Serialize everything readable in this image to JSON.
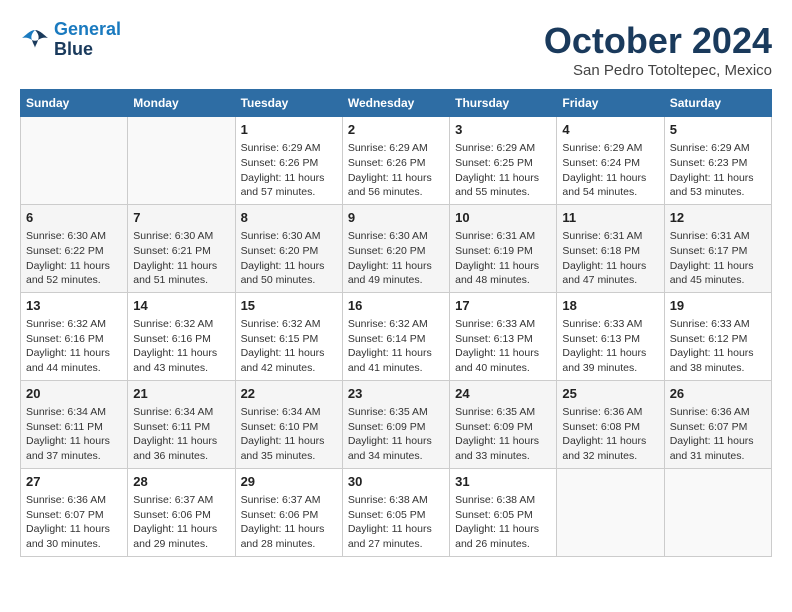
{
  "logo": {
    "line1": "General",
    "line2": "Blue"
  },
  "title": "October 2024",
  "subtitle": "San Pedro Totoltepec, Mexico",
  "weekdays": [
    "Sunday",
    "Monday",
    "Tuesday",
    "Wednesday",
    "Thursday",
    "Friday",
    "Saturday"
  ],
  "weeks": [
    [
      {
        "day": "",
        "info": ""
      },
      {
        "day": "",
        "info": ""
      },
      {
        "day": "1",
        "info": "Sunrise: 6:29 AM\nSunset: 6:26 PM\nDaylight: 11 hours and 57 minutes."
      },
      {
        "day": "2",
        "info": "Sunrise: 6:29 AM\nSunset: 6:26 PM\nDaylight: 11 hours and 56 minutes."
      },
      {
        "day": "3",
        "info": "Sunrise: 6:29 AM\nSunset: 6:25 PM\nDaylight: 11 hours and 55 minutes."
      },
      {
        "day": "4",
        "info": "Sunrise: 6:29 AM\nSunset: 6:24 PM\nDaylight: 11 hours and 54 minutes."
      },
      {
        "day": "5",
        "info": "Sunrise: 6:29 AM\nSunset: 6:23 PM\nDaylight: 11 hours and 53 minutes."
      }
    ],
    [
      {
        "day": "6",
        "info": "Sunrise: 6:30 AM\nSunset: 6:22 PM\nDaylight: 11 hours and 52 minutes."
      },
      {
        "day": "7",
        "info": "Sunrise: 6:30 AM\nSunset: 6:21 PM\nDaylight: 11 hours and 51 minutes."
      },
      {
        "day": "8",
        "info": "Sunrise: 6:30 AM\nSunset: 6:20 PM\nDaylight: 11 hours and 50 minutes."
      },
      {
        "day": "9",
        "info": "Sunrise: 6:30 AM\nSunset: 6:20 PM\nDaylight: 11 hours and 49 minutes."
      },
      {
        "day": "10",
        "info": "Sunrise: 6:31 AM\nSunset: 6:19 PM\nDaylight: 11 hours and 48 minutes."
      },
      {
        "day": "11",
        "info": "Sunrise: 6:31 AM\nSunset: 6:18 PM\nDaylight: 11 hours and 47 minutes."
      },
      {
        "day": "12",
        "info": "Sunrise: 6:31 AM\nSunset: 6:17 PM\nDaylight: 11 hours and 45 minutes."
      }
    ],
    [
      {
        "day": "13",
        "info": "Sunrise: 6:32 AM\nSunset: 6:16 PM\nDaylight: 11 hours and 44 minutes."
      },
      {
        "day": "14",
        "info": "Sunrise: 6:32 AM\nSunset: 6:16 PM\nDaylight: 11 hours and 43 minutes."
      },
      {
        "day": "15",
        "info": "Sunrise: 6:32 AM\nSunset: 6:15 PM\nDaylight: 11 hours and 42 minutes."
      },
      {
        "day": "16",
        "info": "Sunrise: 6:32 AM\nSunset: 6:14 PM\nDaylight: 11 hours and 41 minutes."
      },
      {
        "day": "17",
        "info": "Sunrise: 6:33 AM\nSunset: 6:13 PM\nDaylight: 11 hours and 40 minutes."
      },
      {
        "day": "18",
        "info": "Sunrise: 6:33 AM\nSunset: 6:13 PM\nDaylight: 11 hours and 39 minutes."
      },
      {
        "day": "19",
        "info": "Sunrise: 6:33 AM\nSunset: 6:12 PM\nDaylight: 11 hours and 38 minutes."
      }
    ],
    [
      {
        "day": "20",
        "info": "Sunrise: 6:34 AM\nSunset: 6:11 PM\nDaylight: 11 hours and 37 minutes."
      },
      {
        "day": "21",
        "info": "Sunrise: 6:34 AM\nSunset: 6:11 PM\nDaylight: 11 hours and 36 minutes."
      },
      {
        "day": "22",
        "info": "Sunrise: 6:34 AM\nSunset: 6:10 PM\nDaylight: 11 hours and 35 minutes."
      },
      {
        "day": "23",
        "info": "Sunrise: 6:35 AM\nSunset: 6:09 PM\nDaylight: 11 hours and 34 minutes."
      },
      {
        "day": "24",
        "info": "Sunrise: 6:35 AM\nSunset: 6:09 PM\nDaylight: 11 hours and 33 minutes."
      },
      {
        "day": "25",
        "info": "Sunrise: 6:36 AM\nSunset: 6:08 PM\nDaylight: 11 hours and 32 minutes."
      },
      {
        "day": "26",
        "info": "Sunrise: 6:36 AM\nSunset: 6:07 PM\nDaylight: 11 hours and 31 minutes."
      }
    ],
    [
      {
        "day": "27",
        "info": "Sunrise: 6:36 AM\nSunset: 6:07 PM\nDaylight: 11 hours and 30 minutes."
      },
      {
        "day": "28",
        "info": "Sunrise: 6:37 AM\nSunset: 6:06 PM\nDaylight: 11 hours and 29 minutes."
      },
      {
        "day": "29",
        "info": "Sunrise: 6:37 AM\nSunset: 6:06 PM\nDaylight: 11 hours and 28 minutes."
      },
      {
        "day": "30",
        "info": "Sunrise: 6:38 AM\nSunset: 6:05 PM\nDaylight: 11 hours and 27 minutes."
      },
      {
        "day": "31",
        "info": "Sunrise: 6:38 AM\nSunset: 6:05 PM\nDaylight: 11 hours and 26 minutes."
      },
      {
        "day": "",
        "info": ""
      },
      {
        "day": "",
        "info": ""
      }
    ]
  ]
}
